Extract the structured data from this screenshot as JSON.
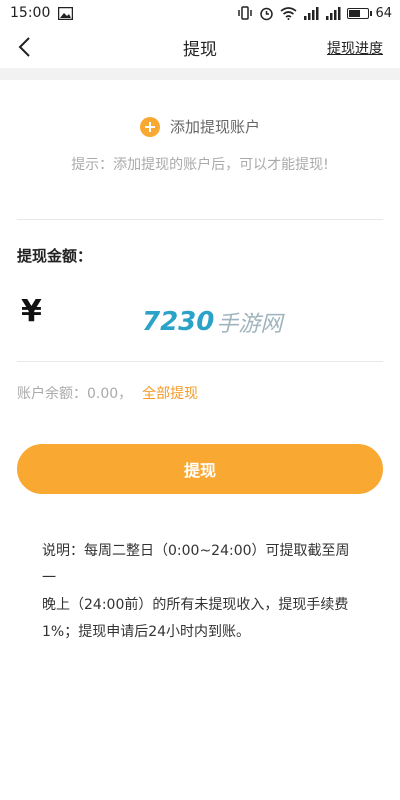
{
  "status_bar": {
    "time": "15:00",
    "battery": "64",
    "battery_level": 0.64
  },
  "header": {
    "title": "提现",
    "right_link": "提现进度"
  },
  "account": {
    "add_label": "添加提现账户",
    "hint": "提示：添加提现的账户后，可以才能提现!"
  },
  "amount": {
    "label": "提现金额：",
    "currency_symbol": "¥",
    "input_value": ""
  },
  "watermark": {
    "number": "7230",
    "text": "手游网"
  },
  "balance": {
    "label": "账户余额：",
    "value": "0.00，",
    "withdraw_all": "全部提现"
  },
  "submit": {
    "label": "提现"
  },
  "note": {
    "line1": "说明：每周二整日（0:00~24:00）可提取截至周一",
    "line2": "晚上（24:00前）的所有未提现收入，提现手续费",
    "line3": "1%；提现申请后24小时内到账。"
  },
  "colors": {
    "accent": "#f9a832",
    "link": "#f39c2a",
    "hint": "#aaaaaa"
  }
}
